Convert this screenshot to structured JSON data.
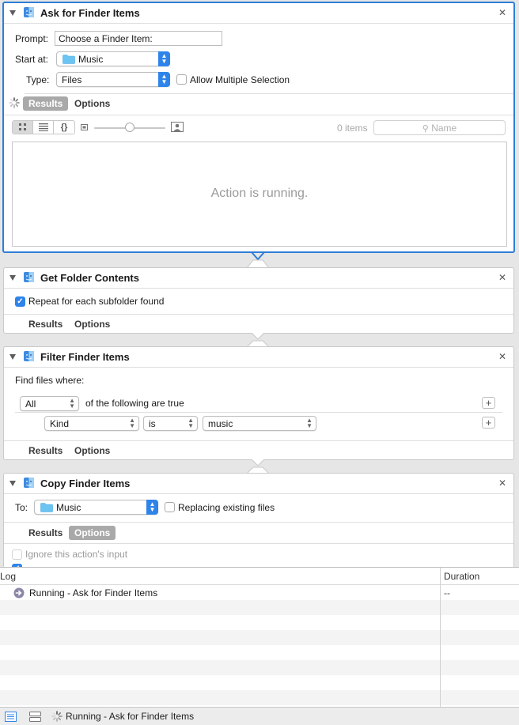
{
  "actions": {
    "ask": {
      "title": "Ask for Finder Items",
      "prompt_label": "Prompt:",
      "prompt_value": "Choose a Finder Item:",
      "start_label": "Start at:",
      "start_value": "Music",
      "type_label": "Type:",
      "type_value": "Files",
      "allow_multiple_label": "Allow Multiple Selection",
      "allow_multiple_checked": false,
      "tab_results": "Results",
      "tab_options": "Options",
      "items_count": "0 items",
      "search_placeholder": "Name",
      "running_text": "Action is running."
    },
    "folder": {
      "title": "Get Folder Contents",
      "repeat_label": "Repeat for each subfolder found",
      "repeat_checked": true,
      "tab_results": "Results",
      "tab_options": "Options"
    },
    "filter": {
      "title": "Filter Finder Items",
      "find_label": "Find files where:",
      "match_value": "All",
      "following_label": "of the following are true",
      "criteria": {
        "field": "Kind",
        "operator": "is",
        "value": "music"
      },
      "tab_results": "Results",
      "tab_options": "Options"
    },
    "copy": {
      "title": "Copy Finder Items",
      "to_label": "To:",
      "to_value": "Music",
      "replacing_label": "Replacing existing files",
      "replacing_checked": false,
      "tab_results": "Results",
      "tab_options": "Options",
      "ignore_input_label": "Ignore this action's input"
    }
  },
  "log": {
    "col_log": "Log",
    "col_duration": "Duration",
    "rows": [
      {
        "message": "Running - Ask for Finder Items",
        "duration": "--"
      }
    ]
  },
  "status": {
    "text": "Running - Ask for Finder Items"
  },
  "colors": {
    "selection_border": "#2f7dd6",
    "accent_blue": "#2f84ea",
    "folder_blue": "#6cc4f3"
  }
}
